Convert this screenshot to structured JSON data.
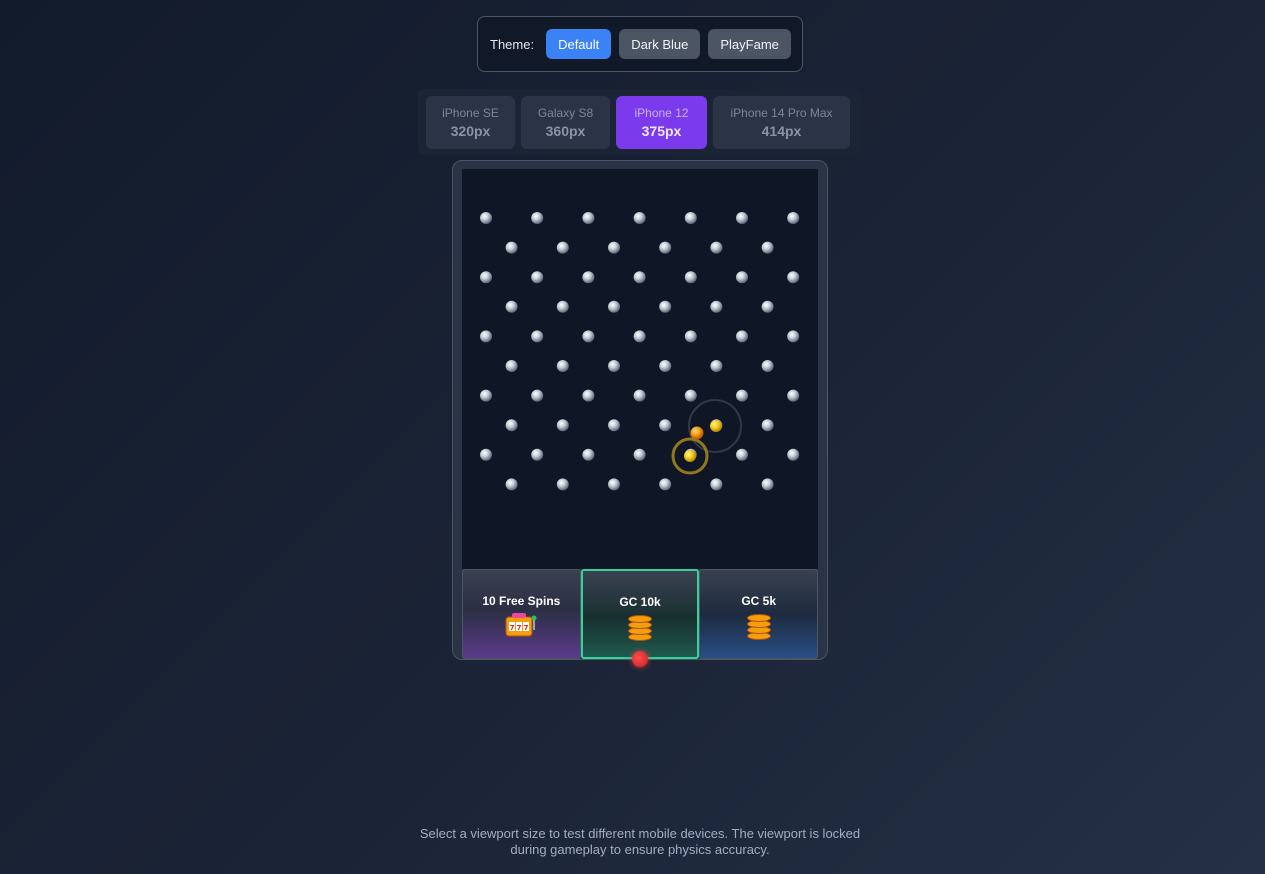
{
  "theme": {
    "label": "Theme:",
    "options": [
      "Default",
      "Dark Blue",
      "PlayFame"
    ],
    "active": "Default"
  },
  "viewports": [
    {
      "name": "iPhone SE",
      "size": "320px"
    },
    {
      "name": "Galaxy S8",
      "size": "360px"
    },
    {
      "name": "iPhone 12",
      "size": "375px"
    },
    {
      "name": "iPhone 14 Pro Max",
      "size": "414px"
    }
  ],
  "active_viewport": "iPhone 12",
  "game": {
    "peg_rows": 10,
    "balls_in_play": 3,
    "slots": [
      {
        "label": "10 Free Spins",
        "icon": "slot-machine-icon"
      },
      {
        "label": "GC 10k",
        "icon": "coins-icon",
        "highlighted": true
      },
      {
        "label": "GC 5k",
        "icon": "coins-icon"
      }
    ]
  },
  "footer": {
    "text": "Select a viewport size to test different mobile devices. The viewport is locked during gameplay to ensure physics accuracy."
  },
  "colors": {
    "accent_blue": "#3b82f6",
    "accent_purple": "#7c3aed",
    "highlight_green": "#34d399",
    "ball_yellow": "#facc15"
  }
}
